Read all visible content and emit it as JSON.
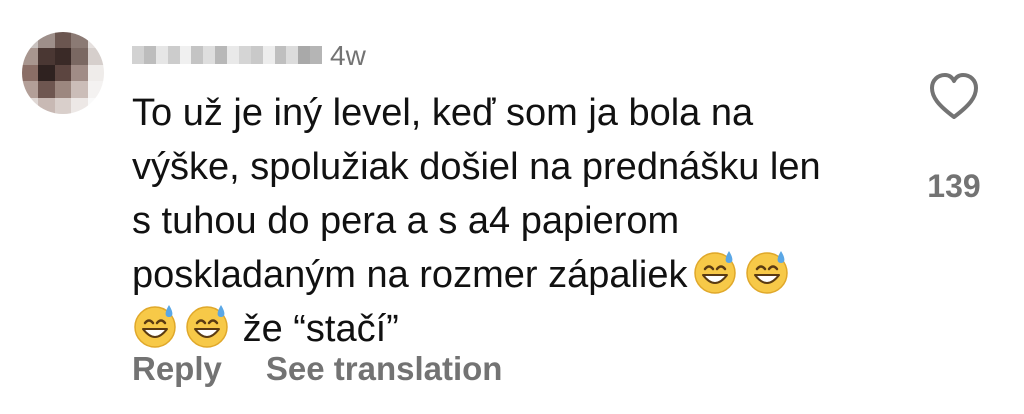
{
  "comment": {
    "avatar": {
      "icon": "blurred-avatar",
      "colors": [
        "#c9c2bf",
        "#9e8f8a",
        "#6b5650",
        "#8b7a74",
        "#e5e0de",
        "#a8968f",
        "#4a3733",
        "#3a2a27",
        "#7a6862",
        "#d6cfcc",
        "#8a6e66",
        "#2f2220",
        "#5c4540",
        "#a08c86",
        "#efecea",
        "#b39f98",
        "#6e5650",
        "#9c877f",
        "#cbbdb8",
        "#f4f2f1",
        "#e0d8d5",
        "#c8b9b4",
        "#d9cfcb",
        "#ede8e6",
        "#fafafa"
      ]
    },
    "username_blur_colors": [
      "#d2d2d2",
      "#bdbdbd",
      "#e6e6e6",
      "#cccccc",
      "#f0f0f0",
      "#c4c4c4",
      "#dedede",
      "#b8b8b8",
      "#e9e9e9",
      "#d5d5d5",
      "#c9c9c9",
      "#ededed",
      "#bfbfbf",
      "#dcdcdc",
      "#a9a9a9",
      "#b5b5b5"
    ],
    "timestamp": "4w",
    "text": {
      "line1": "To už je iný level, keď som ja bola na",
      "line2": "výške, spolužiak došiel na prednášku len",
      "line3": "s tuhou do pera a s a4 papierom",
      "line4": "poskladaným na rozmer zápaliek",
      "line5": "že “stačí”"
    },
    "emoji": "grinning-face-with-sweat",
    "likes": "139",
    "actions": {
      "reply": "Reply",
      "see_translation": "See translation"
    }
  },
  "colors": {
    "text": "#111111",
    "secondary": "#737373",
    "emoji_face": "#f7c948",
    "emoji_sweat": "#5aa7e6"
  }
}
